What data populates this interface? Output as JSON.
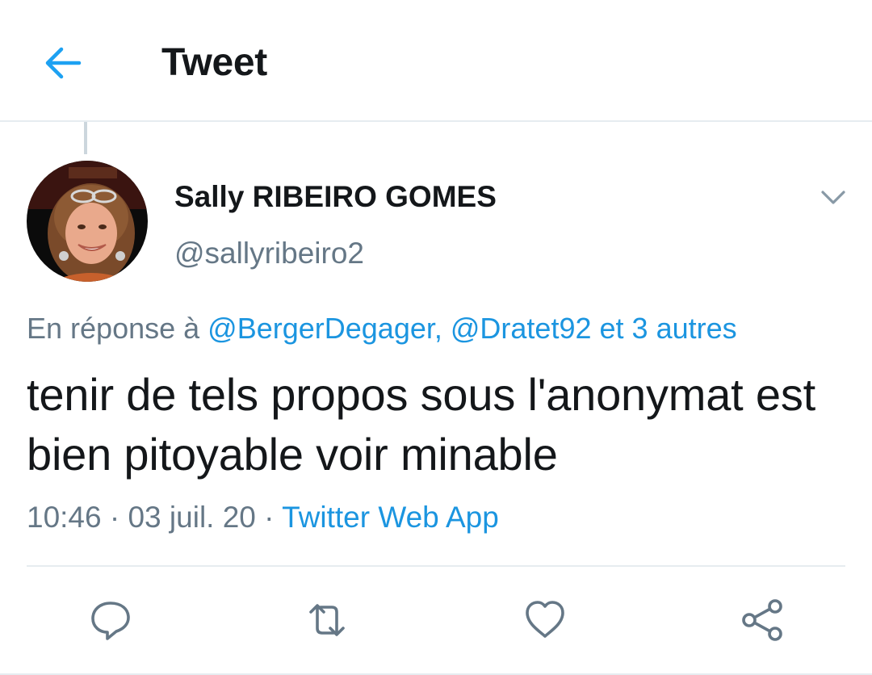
{
  "header": {
    "title": "Tweet",
    "back_icon": "arrow-left-icon",
    "accent_color": "#1da1f2"
  },
  "tweet": {
    "author": {
      "name": "Sally RIBEIRO GOMES",
      "handle": "@sallyribeiro2",
      "avatar_icon": "profile-photo"
    },
    "reply_to": {
      "prefix": "En réponse à",
      "handles": "@BergerDegager, @Dratet92",
      "more": "et 3 autres"
    },
    "text": "tenir de tels propos sous l'anonymat est bien pitoyable voir minable",
    "time": "10:46",
    "separator": "·",
    "date": "03 juil. 20",
    "source": "Twitter Web App"
  },
  "actions": {
    "reply_icon": "reply-icon",
    "retweet_icon": "retweet-icon",
    "like_icon": "heart-icon",
    "share_icon": "share-icon"
  },
  "colors": {
    "text": "#14171a",
    "muted": "#657786",
    "link": "#1b95e0",
    "border": "#e6ecf0"
  }
}
